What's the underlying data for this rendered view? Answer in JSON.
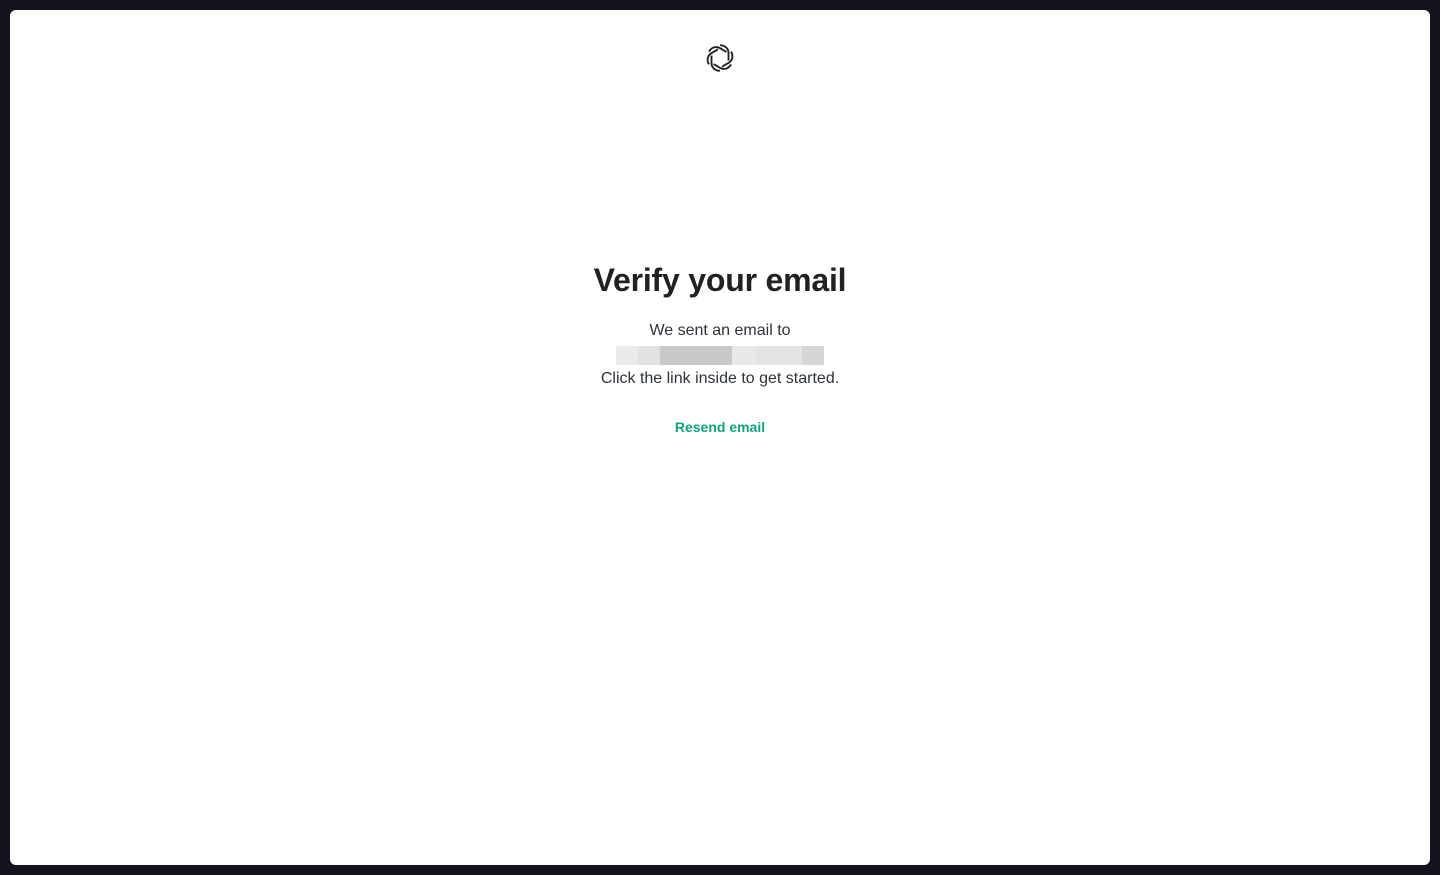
{
  "brand": {
    "logo_icon": "openai-logo-icon",
    "accent_color": "#10a37f"
  },
  "verify": {
    "title": "Verify your email",
    "sent_text": "We sent an email to",
    "email": "[redacted]",
    "instruction": "Click the link inside to get started.",
    "resend_label": "Resend email"
  }
}
